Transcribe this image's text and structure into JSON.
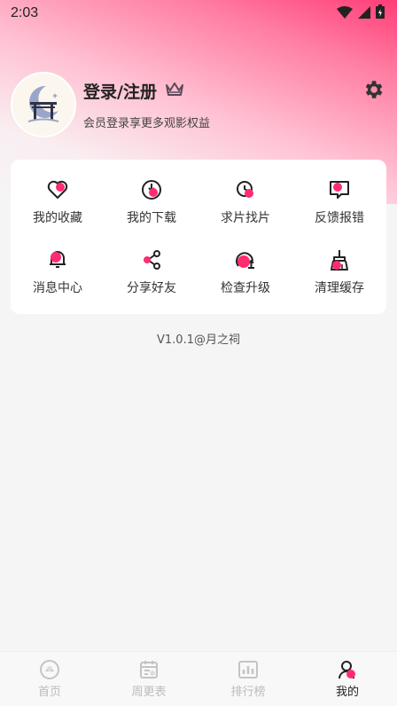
{
  "status": {
    "time": "2:03",
    "icons": [
      "wifi-icon",
      "signal-icon",
      "battery-icon"
    ]
  },
  "profile": {
    "title": "登录/注册",
    "subtitle": "会员登录享更多观影权益",
    "icons": [
      "avatar-torii-moon-icon",
      "crown-icon",
      "gear-icon"
    ]
  },
  "grid": {
    "items": [
      {
        "label": "我的收藏",
        "icon": "heart-icon"
      },
      {
        "label": "我的下载",
        "icon": "download-icon"
      },
      {
        "label": "求片找片",
        "icon": "search-movie-icon"
      },
      {
        "label": "反馈报错",
        "icon": "feedback-icon"
      },
      {
        "label": "消息中心",
        "icon": "bell-icon"
      },
      {
        "label": "分享好友",
        "icon": "share-icon"
      },
      {
        "label": "检查升级",
        "icon": "upgrade-icon"
      },
      {
        "label": "清理缓存",
        "icon": "broom-icon"
      }
    ]
  },
  "version": "V1.0.1@月之祠",
  "nav": {
    "items": [
      {
        "label": "首页",
        "icon": "home-icon",
        "active": false
      },
      {
        "label": "周更表",
        "icon": "calendar-icon",
        "active": false
      },
      {
        "label": "排行榜",
        "icon": "ranking-icon",
        "active": false
      },
      {
        "label": "我的",
        "icon": "profile-icon",
        "active": true
      }
    ]
  },
  "colors": {
    "accent": "#ff2d6f",
    "gradient_top": "#ff3d77",
    "background": "#f5f5f5",
    "inactive_nav": "#bbbbbb"
  }
}
